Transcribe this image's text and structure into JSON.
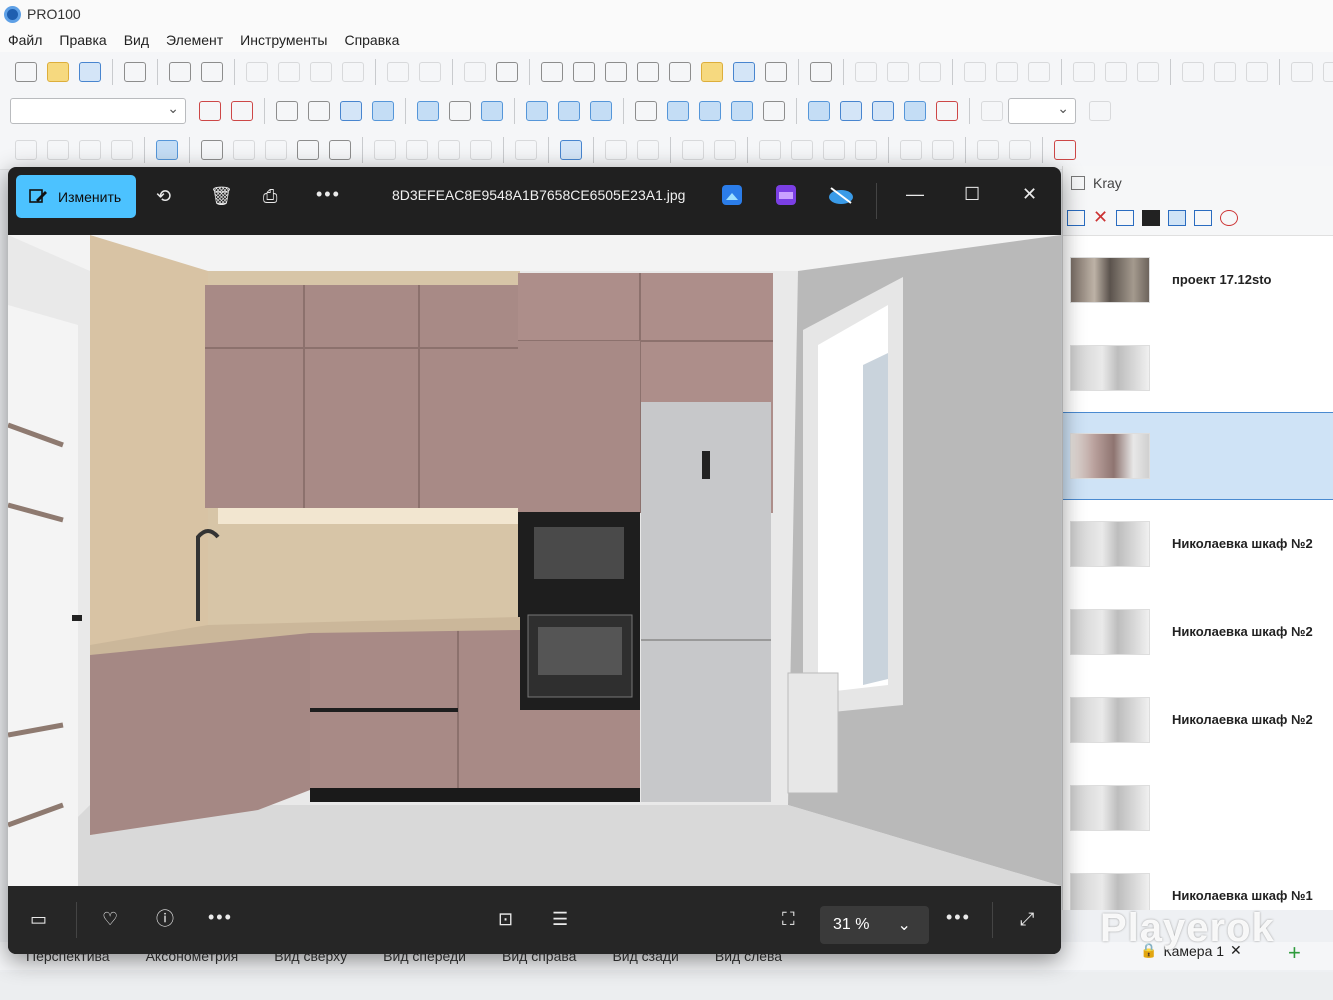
{
  "app": {
    "title": "PRO100"
  },
  "menu": [
    "Файл",
    "Правка",
    "Вид",
    "Элемент",
    "Инструменты",
    "Справка"
  ],
  "viewer": {
    "edit_label": "Изменить",
    "filename": "8D3EFEAC8E9548A1B7658CE6505E23A1.jpg",
    "zoom": "31 %"
  },
  "panel": {
    "title": "Kray",
    "items": [
      {
        "label": "проект 17.12sto"
      },
      {
        "label": ""
      },
      {
        "label": ""
      },
      {
        "label": "Николаевка шкаф №2"
      },
      {
        "label": "Николаевка шкаф №2"
      },
      {
        "label": "Николаевка шкаф №2"
      },
      {
        "label": ""
      },
      {
        "label": "Николаевка шкаф №1"
      }
    ]
  },
  "view_tabs": [
    "Перспектива",
    "Аксонометрия",
    "Вид сверху",
    "Вид спереди",
    "Вид справа",
    "Вид сзади",
    "Вид слева"
  ],
  "camera": {
    "label": "Камера 1"
  },
  "watermark": "Playerok",
  "colors": {
    "accent": "#4cc2ff",
    "selection": "#cfe3f6",
    "cabinet": "#a88a86"
  }
}
